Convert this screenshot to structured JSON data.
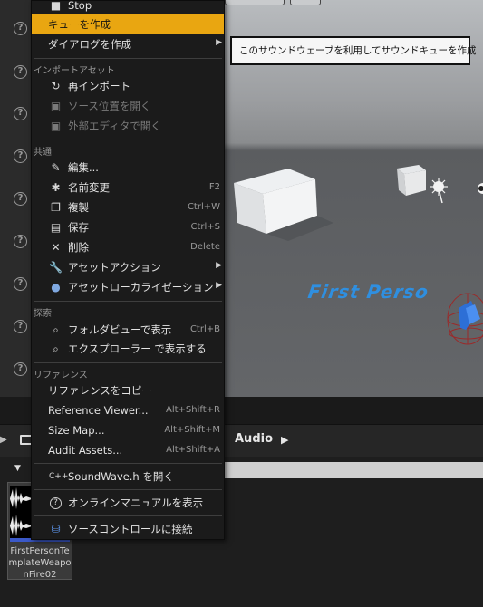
{
  "context_menu": {
    "stop_label": "Stop",
    "create_cue_label": "キューを作成",
    "dialog_create_label": "ダイアログを作成",
    "section_import": "インポートアセット",
    "reimport_label": "再インポート",
    "open_source_label": "ソース位置を開く",
    "open_external_label": "外部エディタで開く",
    "section_common": "共通",
    "edit_label": "編集...",
    "rename_label": "名前変更",
    "rename_shortcut": "F2",
    "duplicate_label": "複製",
    "duplicate_shortcut": "Ctrl+W",
    "save_label": "保存",
    "save_shortcut": "Ctrl+S",
    "delete_label": "削除",
    "delete_shortcut": "Delete",
    "asset_actions_label": "アセットアクション",
    "asset_localization_label": "アセットローカライゼーション",
    "section_explore": "探索",
    "show_in_folder_view_label": "フォルダビューで表示",
    "show_in_folder_view_shortcut": "Ctrl+B",
    "show_in_explorer_label": "エクスプローラー で表示する",
    "section_references": "リファレンス",
    "copy_reference_label": "リファレンスをコピー",
    "reference_viewer_label": "Reference Viewer...",
    "reference_viewer_shortcut": "Alt+Shift+R",
    "size_map_label": "Size Map...",
    "size_map_shortcut": "Alt+Shift+M",
    "audit_assets_label": "Audit Assets...",
    "audit_assets_shortcut": "Alt+Shift+A",
    "open_header_label": "SoundWave.h を開く",
    "online_manual_label": "オンラインマニュアルを表示",
    "source_control_label": "ソースコントロールに接続"
  },
  "tooltip": {
    "text": "このサウンドウェーブを利用してサウンドキューを作成"
  },
  "viewport": {
    "overlay_text": "First Perso"
  },
  "content_browser": {
    "path_segment": "Audio",
    "asset_name": "FirstPersonTemplateWeaponFire02"
  },
  "colors": {
    "highlight": "#e9a611",
    "menu_bg": "#1b1b1b",
    "asset_bar": "#3b59c9"
  }
}
